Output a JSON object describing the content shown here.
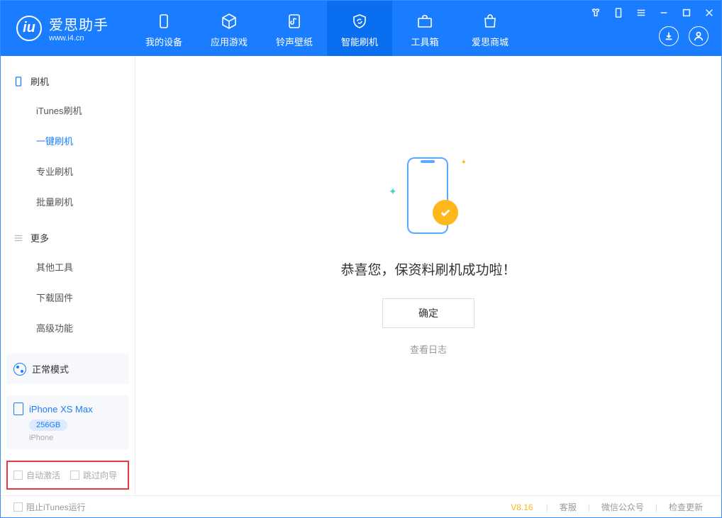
{
  "app": {
    "title": "爱思助手",
    "subtitle": "www.i4.cn"
  },
  "tabs": [
    {
      "label": "我的设备"
    },
    {
      "label": "应用游戏"
    },
    {
      "label": "铃声壁纸"
    },
    {
      "label": "智能刷机"
    },
    {
      "label": "工具箱"
    },
    {
      "label": "爱思商城"
    }
  ],
  "sidebar": {
    "group1": {
      "title": "刷机",
      "items": [
        "iTunes刷机",
        "一键刷机",
        "专业刷机",
        "批量刷机"
      ]
    },
    "group2": {
      "title": "更多",
      "items": [
        "其他工具",
        "下载固件",
        "高级功能"
      ]
    }
  },
  "device": {
    "mode": "正常模式",
    "name": "iPhone XS Max",
    "storage": "256GB",
    "type": "iPhone"
  },
  "checkboxes": {
    "auto_activate": "自动激活",
    "skip_guide": "跳过向导"
  },
  "main": {
    "success_message": "恭喜您，保资料刷机成功啦！",
    "ok_button": "确定",
    "view_log": "查看日志"
  },
  "footer": {
    "block_itunes": "阻止iTunes运行",
    "version": "V8.16",
    "links": [
      "客服",
      "微信公众号",
      "检查更新"
    ]
  }
}
